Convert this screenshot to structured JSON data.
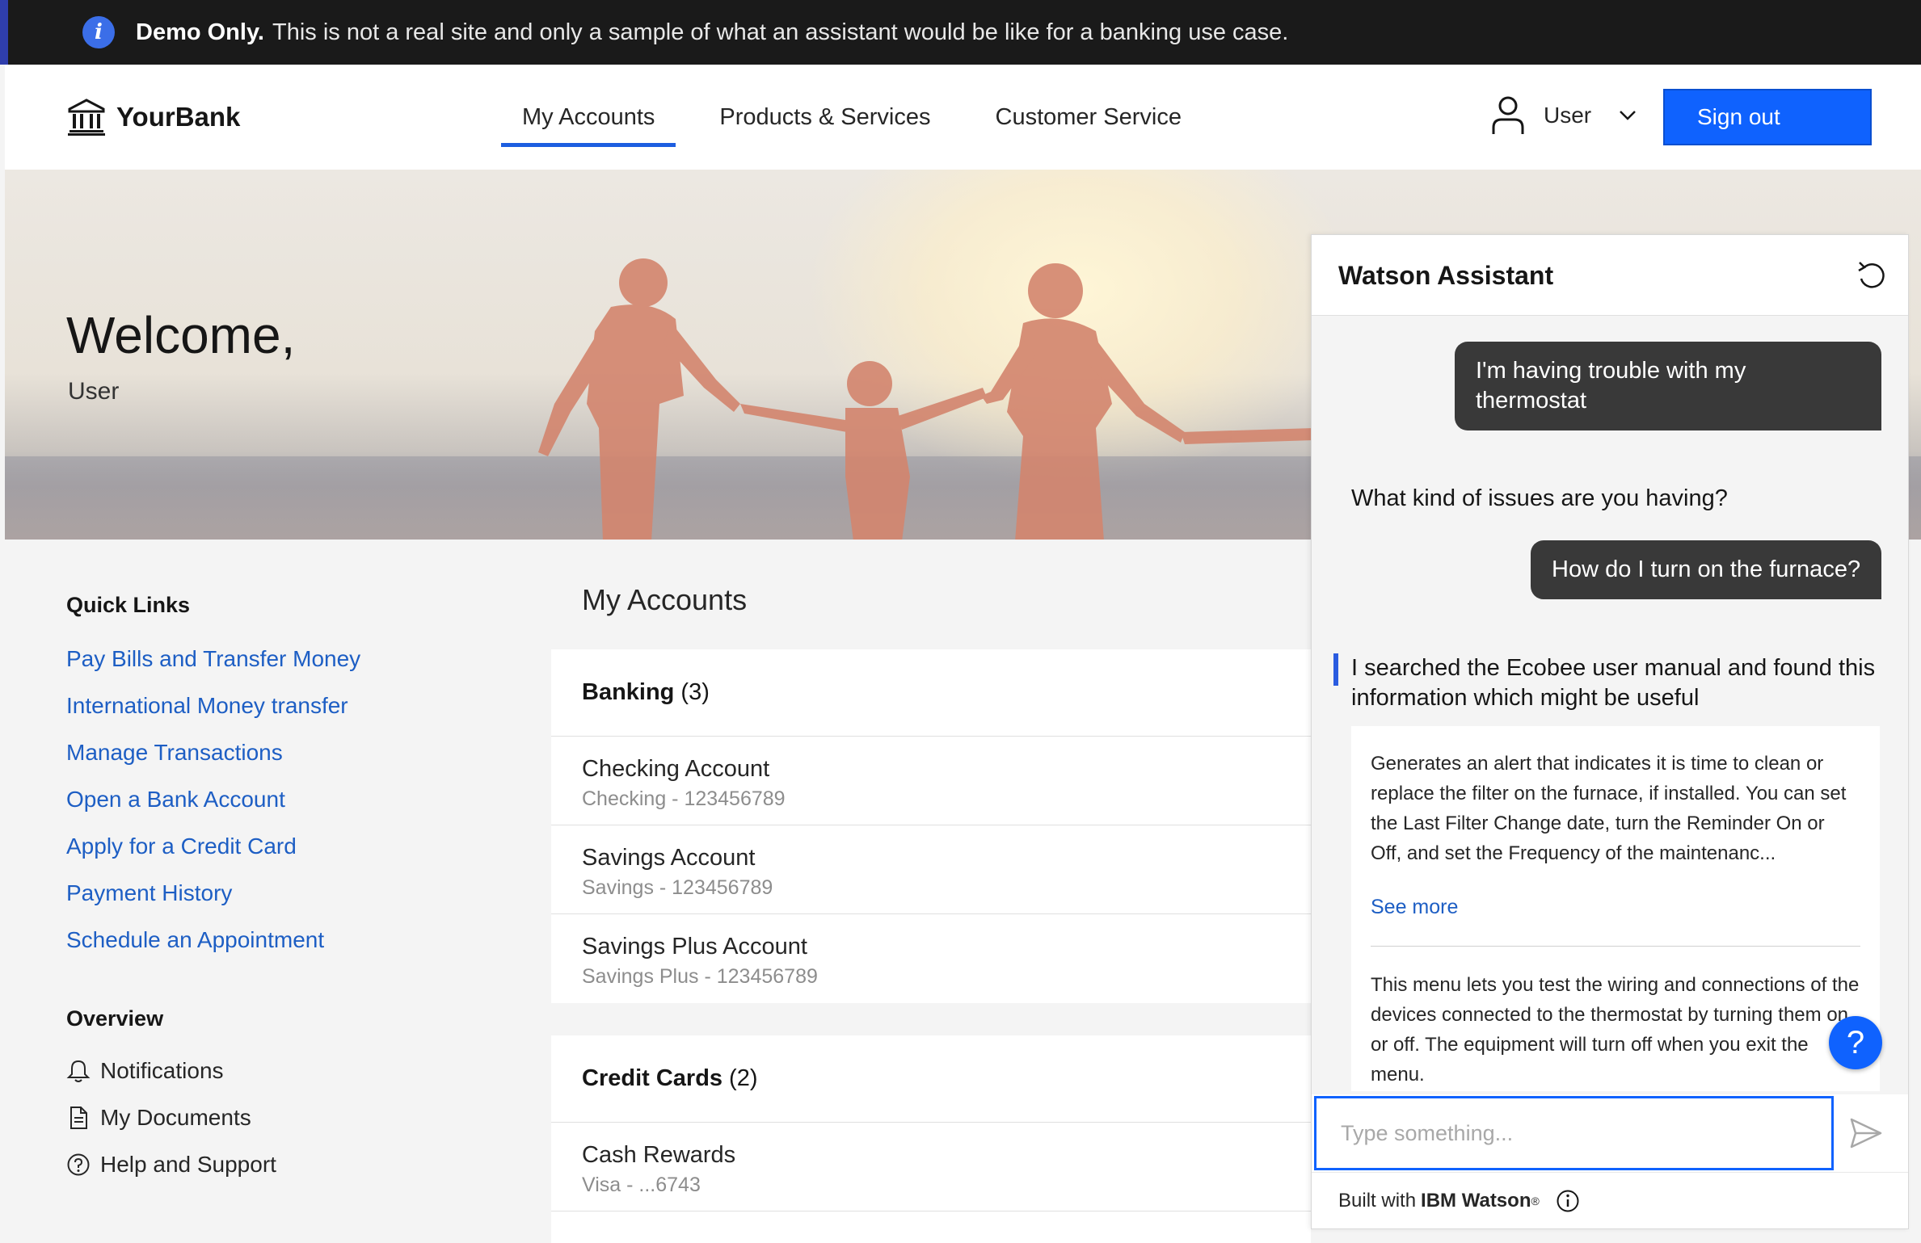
{
  "banner": {
    "bold": "Demo Only.",
    "message": "This is not a real site and only a sample of what an assistant would be like for a banking use case."
  },
  "header": {
    "logo_text": "YourBank",
    "nav": [
      "My Accounts",
      "Products & Services",
      "Customer Service"
    ],
    "user_label": "User",
    "sign_out": "Sign out"
  },
  "hero": {
    "welcome": "Welcome,",
    "user": "User"
  },
  "quick_links": {
    "title": "Quick Links",
    "items": [
      "Pay Bills and Transfer Money",
      "International Money transfer",
      "Manage Transactions",
      "Open a Bank Account",
      "Apply for a Credit Card",
      "Payment History",
      "Schedule an Appointment"
    ]
  },
  "overview": {
    "title": "Overview",
    "items": [
      {
        "label": "Notifications",
        "icon": "bell-icon"
      },
      {
        "label": "My Documents",
        "icon": "document-icon"
      },
      {
        "label": "Help and Support",
        "icon": "help-icon"
      }
    ]
  },
  "accounts": {
    "title": "My Accounts",
    "banking": {
      "title": "Banking",
      "count": "(3)",
      "rows": [
        {
          "name": "Checking Account",
          "sub": "Checking - 123456789"
        },
        {
          "name": "Savings Account",
          "sub": "Savings - 123456789"
        },
        {
          "name": "Savings Plus Account",
          "sub": "Savings Plus - 123456789"
        }
      ]
    },
    "credit": {
      "title": "Credit Cards",
      "count": "(2)",
      "rows": [
        {
          "name": "Cash Rewards",
          "sub": "Visa - ...6743"
        }
      ]
    }
  },
  "chat": {
    "title": "Watson Assistant",
    "messages": {
      "user1": "I'm having trouble with my thermostat",
      "bot1": "What kind of issues are you having?",
      "user2": "How do I turn on the furnace?",
      "bot2": "I searched the Ecobee user manual and found this information which might be useful"
    },
    "result1": "Generates an alert that indicates it is time to clean or replace the filter on the furnace, if installed. You can set the Last Filter Change date, turn the Reminder On or Off, and set the Frequency of the maintenanc...",
    "see_more": "See more",
    "result2": "This menu lets you test the wiring and connections of the devices connected to the thermostat by turning them on or off. The equipment will turn off when you exit the menu.",
    "help_glyph": "?",
    "input_placeholder": "Type something...",
    "footer_prefix": "Built with",
    "footer_brand": "IBM Watson",
    "footer_mark": "®"
  },
  "colors": {
    "brand_blue": "#0f62fe",
    "link_blue": "#1d5ec4",
    "banner_bg": "#1a1a1a",
    "bubble_bg": "#393939"
  }
}
